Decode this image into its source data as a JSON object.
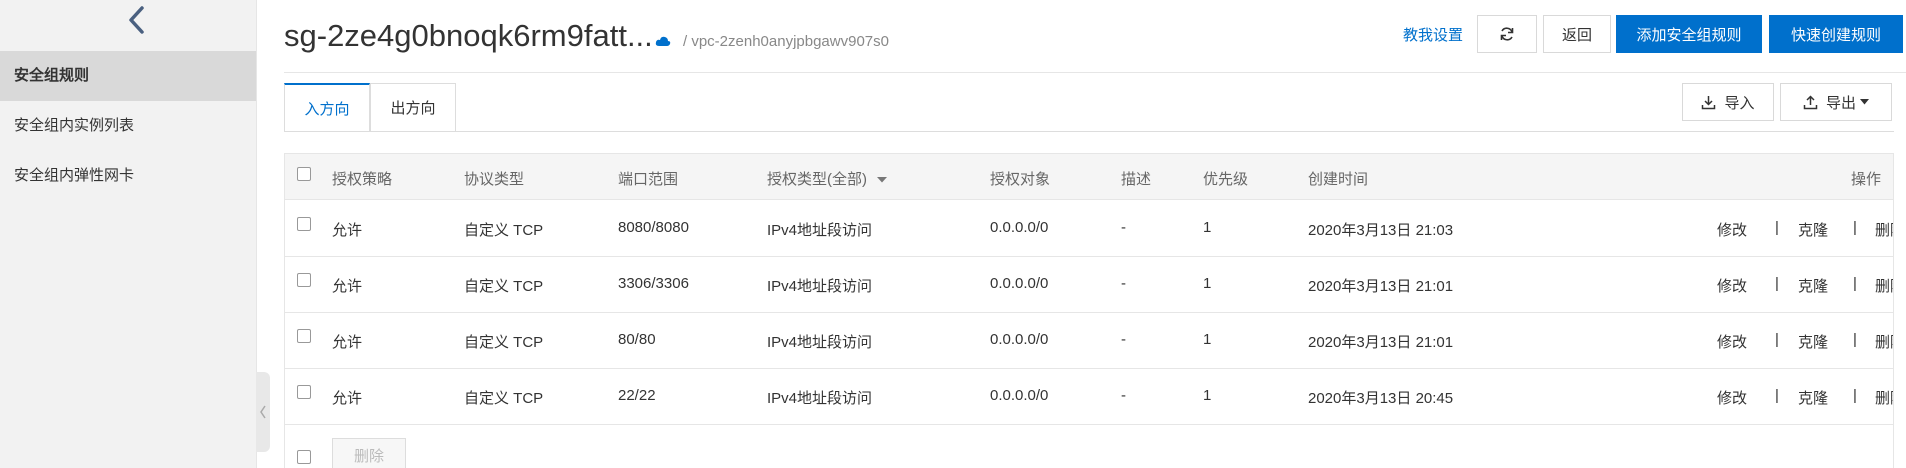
{
  "sidebar": {
    "items": [
      {
        "label": "安全组规则",
        "active": true
      },
      {
        "label": "安全组内实例列表",
        "active": false
      },
      {
        "label": "安全组内弹性网卡",
        "active": false
      }
    ]
  },
  "header": {
    "title": "sg-2ze4g0bnoqk6rm9fatt...",
    "vpc": "/ vpc-2zenh0anyjpbgawv907s0",
    "help_link": "教我设置",
    "back_label": "返回",
    "add_rule_label": "添加安全组规则",
    "quick_create_label": "快速创建规则"
  },
  "tabs": [
    {
      "label": "入方向",
      "active": true
    },
    {
      "label": "出方向",
      "active": false
    }
  ],
  "toolbar": {
    "import_label": "导入",
    "export_label": "导出"
  },
  "table": {
    "headers": {
      "policy": "授权策略",
      "protocol": "协议类型",
      "port": "端口范围",
      "auth_type": "授权类型(全部)",
      "auth_object": "授权对象",
      "desc": "描述",
      "priority": "优先级",
      "created": "创建时间",
      "ops": "操作"
    },
    "rows": [
      {
        "policy": "允许",
        "protocol": "自定义 TCP",
        "port": "8080/8080",
        "auth_type": "IPv4地址段访问",
        "auth_object": "0.0.0.0/0",
        "desc": "-",
        "priority": "1",
        "created": "2020年3月13日 21:03"
      },
      {
        "policy": "允许",
        "protocol": "自定义 TCP",
        "port": "3306/3306",
        "auth_type": "IPv4地址段访问",
        "auth_object": "0.0.0.0/0",
        "desc": "-",
        "priority": "1",
        "created": "2020年3月13日 21:01"
      },
      {
        "policy": "允许",
        "protocol": "自定义 TCP",
        "port": "80/80",
        "auth_type": "IPv4地址段访问",
        "auth_object": "0.0.0.0/0",
        "desc": "-",
        "priority": "1",
        "created": "2020年3月13日 21:01"
      },
      {
        "policy": "允许",
        "protocol": "自定义 TCP",
        "port": "22/22",
        "auth_type": "IPv4地址段访问",
        "auth_object": "0.0.0.0/0",
        "desc": "-",
        "priority": "1",
        "created": "2020年3月13日 20:45"
      }
    ],
    "actions": {
      "edit": "修改",
      "clone": "克隆",
      "delete": "删除",
      "separator": "|"
    },
    "batch_delete_label": "删除"
  },
  "colors": {
    "accent": "#0070cc",
    "sidebar_bg": "#f2f2f2",
    "sidebar_active": "#d9d9d9"
  }
}
